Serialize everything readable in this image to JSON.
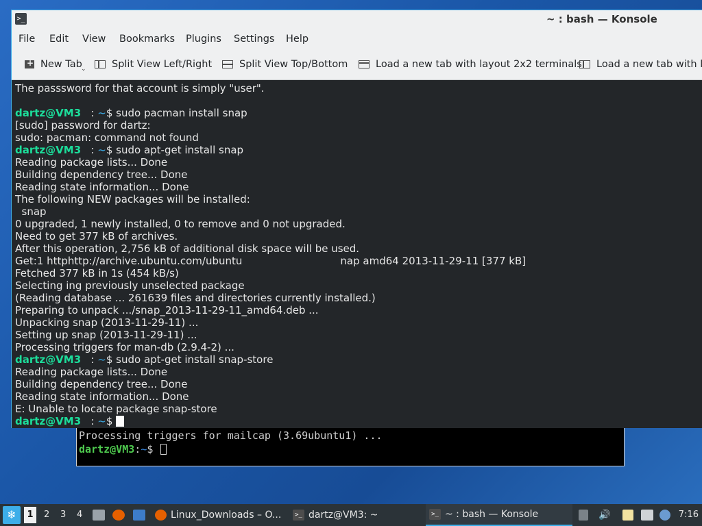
{
  "colors": {
    "accent": "#3daee9",
    "prompt_user": "#1cdc9a",
    "terminal_bg": "#232629",
    "taskbar_bg": "#2b3338"
  },
  "background_terminal": {
    "line1": "Processing triggers for mailcap (3.69ubuntu1) ...",
    "prompt_user": "dartz@VM3",
    "prompt_sep": ":",
    "prompt_path": "~",
    "prompt_end": "$ "
  },
  "window": {
    "title": "~ : bash — Konsole",
    "menu": [
      "File",
      "Edit",
      "View",
      "Bookmarks",
      "Plugins",
      "Settings",
      "Help"
    ],
    "toolbar": {
      "new_tab": "New Tab",
      "split_lr": "Split View Left/Right",
      "split_tb": "Split View Top/Bottom",
      "layout_2x2": "Load a new tab with layout 2x2 terminals",
      "layout_cut": "Load a new tab with lay"
    }
  },
  "terminal": {
    "prompt": {
      "user": "dartz@VM3",
      "sep": "   : ",
      "path": "~",
      "dollar": "$ "
    },
    "lines": [
      "The passsword for that account is simply \"user\".",
      "",
      "sudo pacman install snap",
      "[sudo] password for dartz:",
      "sudo: pacman: command not found",
      "sudo apt-get install snap",
      "Reading package lists... Done",
      "Building dependency tree... Done",
      "Reading state information... Done",
      "The following NEW packages will be installed:",
      "  snap",
      "0 upgraded, 1 newly installed, 0 to remove and 0 not upgraded.",
      "Need to get 377 kB of archives.",
      "After this operation, 2,756 kB of additional disk space will be used.",
      "Get:1 httphttp://archive.ubuntu.com/ubuntu                              nap amd64 2013-11-29-11 [377 kB]",
      "Fetched 377 kB in 1s (454 kB/s)",
      "Selecting ing previously unselected package",
      "(Reading database ... 261639 files and directories currently installed.)",
      "Preparing to unpack .../snap_2013-11-29-11_amd64.deb ...",
      "Unpacking snap (2013-11-29-11) ...",
      "Setting up snap (2013-11-29-11) ...",
      "Processing triggers for man-db (2.9.4-2) ...",
      "sudo apt-get install snap-store",
      "Reading package lists... Done",
      "Building dependency tree... Done",
      "Reading state information... Done",
      "E: Unable to locate package snap-store",
      ""
    ]
  },
  "taskbar": {
    "workspaces": [
      "1",
      "2",
      "3",
      "4"
    ],
    "tasks": [
      "Linux_Downloads – O...",
      "dartz@VM3: ~",
      "~ : bash — Konsole"
    ],
    "clock": "7:16"
  }
}
